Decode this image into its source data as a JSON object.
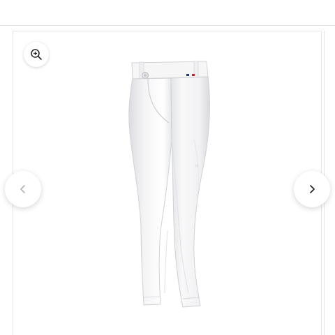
{
  "gallery": {
    "zoom_icon": "zoom-in-icon",
    "prev_icon": "chevron-left-icon",
    "next_icon": "chevron-right-icon",
    "product_image": "white-riding-breeches",
    "colors": {
      "arrow_prev": "#b3b3b3",
      "arrow_next": "#222222",
      "border": "#e6e6e6"
    }
  }
}
